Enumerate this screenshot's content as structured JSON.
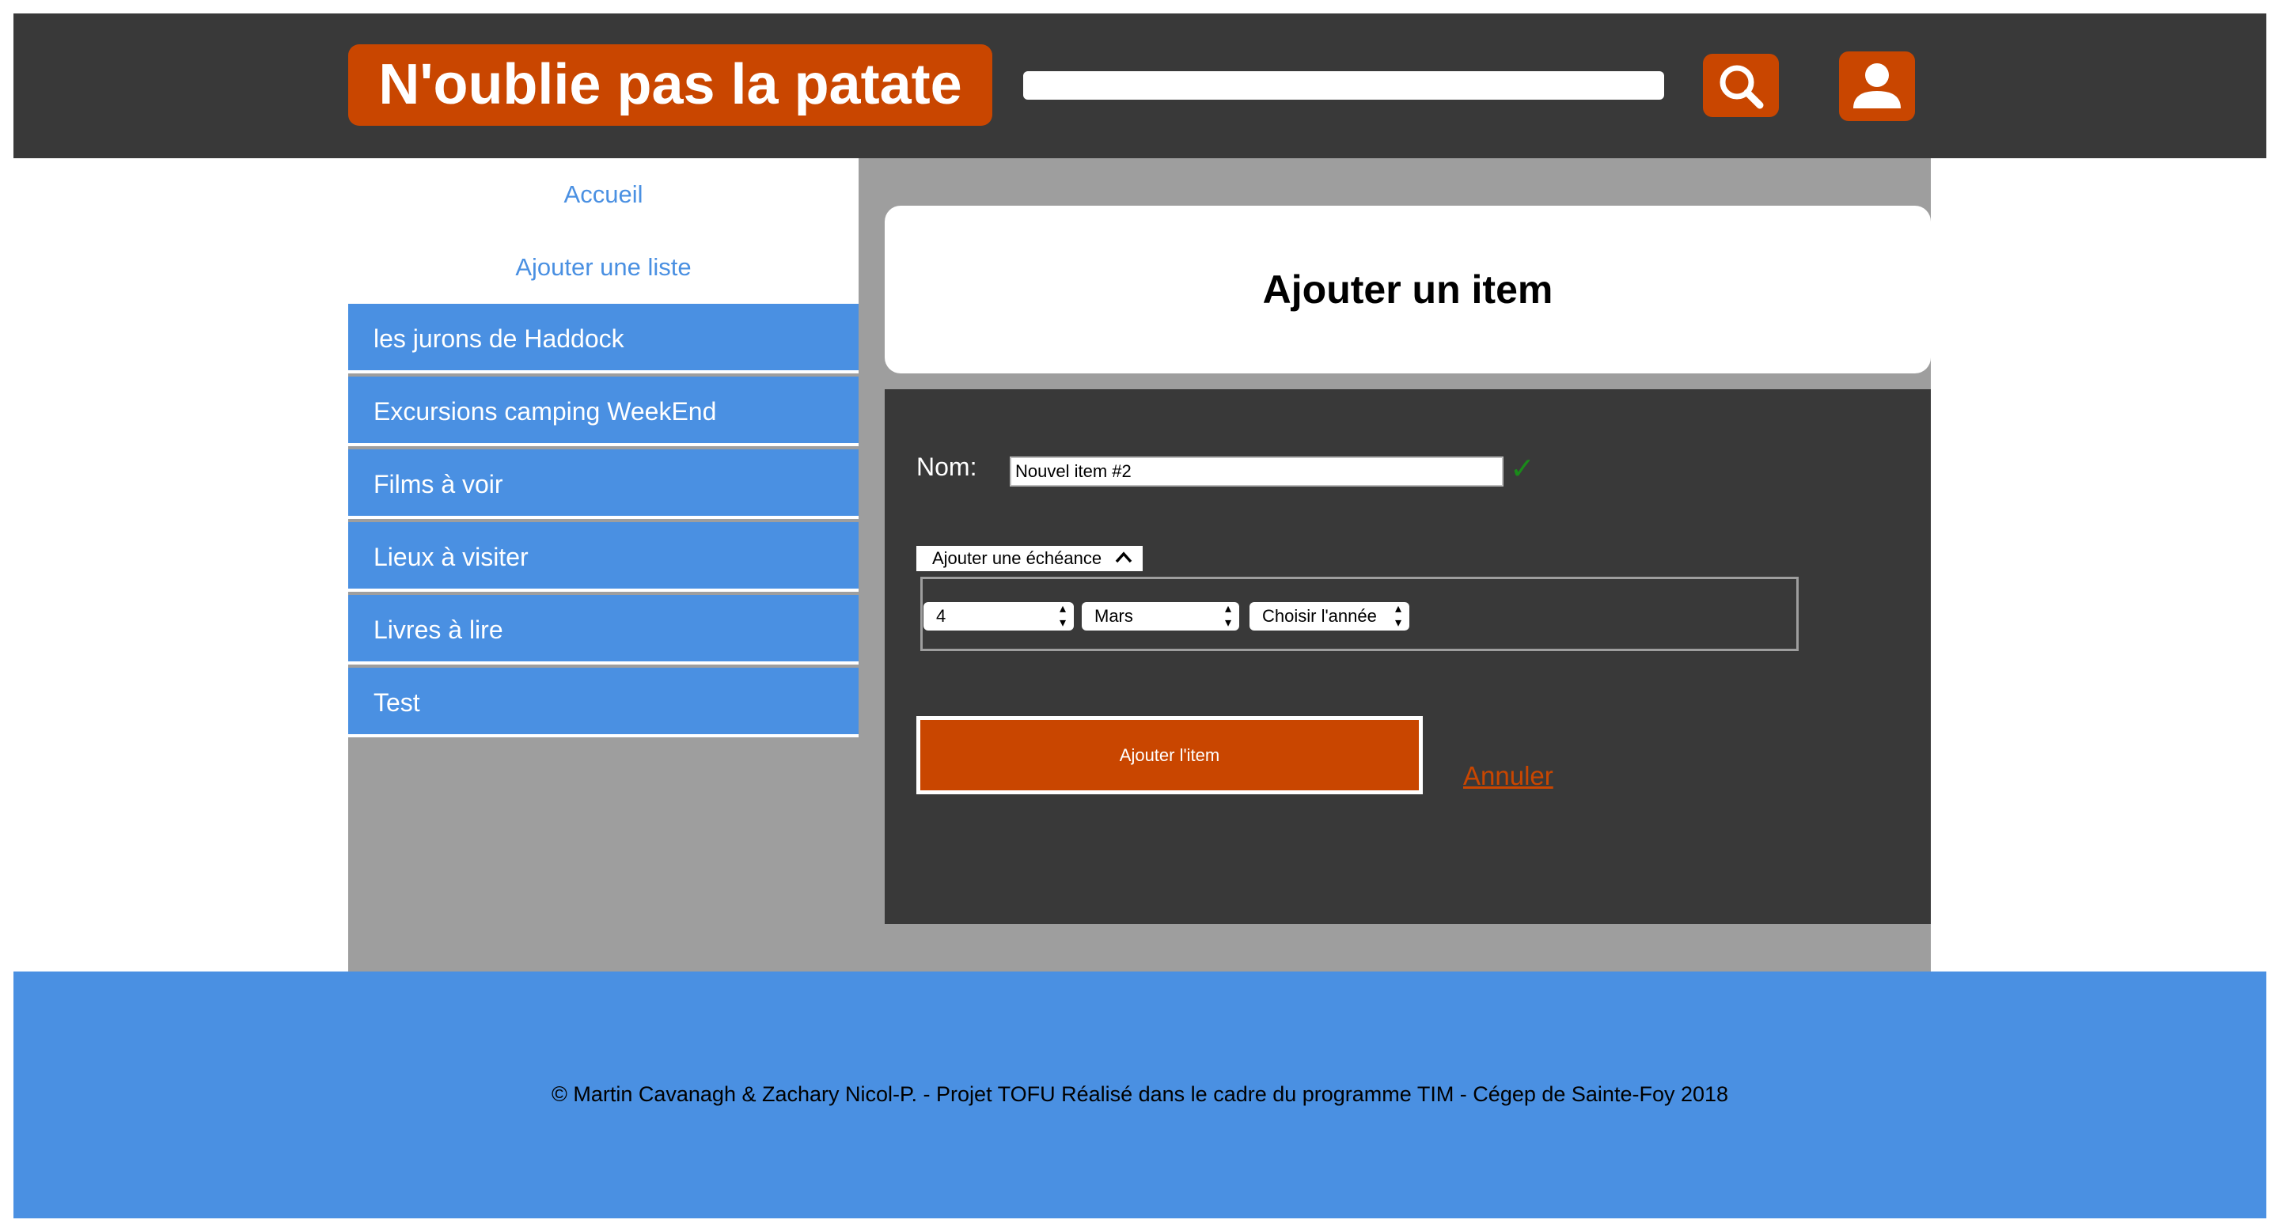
{
  "header": {
    "logo_text": "N'oublie pas la patate",
    "search_value": "",
    "icons": {
      "search": "search-icon",
      "user": "user-icon"
    },
    "accent_color": "#c94600",
    "bar_color": "#393939"
  },
  "sidebar": {
    "links": [
      {
        "label": "Accueil"
      },
      {
        "label": "Ajouter une liste"
      }
    ],
    "lists": [
      {
        "label": "les jurons de Haddock"
      },
      {
        "label": "Excursions camping WeekEnd"
      },
      {
        "label": "Films à voir"
      },
      {
        "label": "Lieux à visiter"
      },
      {
        "label": "Livres à lire"
      },
      {
        "label": "Test"
      }
    ],
    "list_color": "#4a90e2"
  },
  "main": {
    "title": "Ajouter un item",
    "form": {
      "name_label": "Nom:",
      "name_value": "Nouvel item #2",
      "valid_mark": "✓",
      "deadline_toggle": "Ajouter une échéance",
      "day": {
        "selected": "4"
      },
      "month": {
        "selected": "Mars"
      },
      "year": {
        "selected": "Choisir l'année"
      },
      "submit_label": "Ajouter l'item",
      "cancel_label": "Annuler"
    }
  },
  "footer": {
    "text": "© Martin Cavanagh & Zachary Nicol-P. - Projet TOFU Réalisé dans le cadre du programme TIM - Cégep de Sainte-Foy 2018",
    "color": "#4a90e2"
  }
}
